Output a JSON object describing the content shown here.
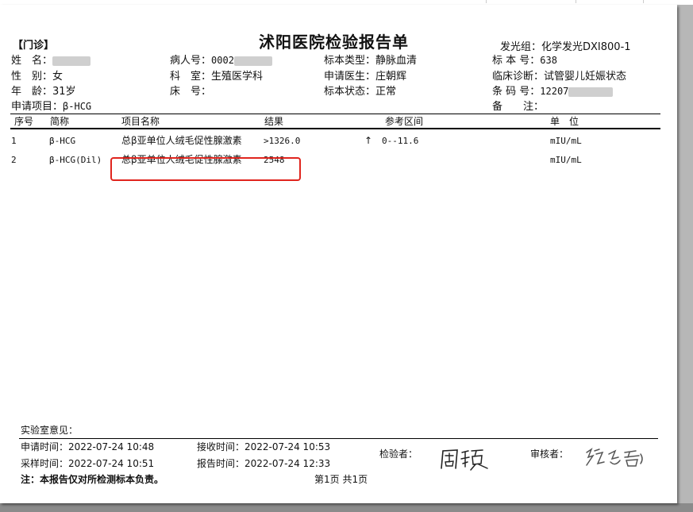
{
  "header": {
    "clinic": "【门诊】",
    "title": "沭阳医院检验报告单",
    "instrument_group": "发光组：化学发光DXI800-1"
  },
  "patient": {
    "name_label": "姓　名：",
    "gender_label": "性　别：",
    "gender_value": "女",
    "age_label": "年　龄：",
    "age_value": "31岁",
    "request_label": "申请项目：",
    "request_value": "β-HCG",
    "patient_no_label": "病人号：",
    "patient_no_value": "0002",
    "dept_label": "科　室：",
    "dept_value": "生殖医学科",
    "bed_label": "床　号：",
    "bed_value": "",
    "specimen_type_label": "标本类型：",
    "specimen_type_value": "静脉血清",
    "doctor_label": "申请医生：",
    "doctor_value": "庄朝辉",
    "specimen_status_label": "标本状态：",
    "specimen_status_value": "正常",
    "specimen_no_label": "标 本 号：",
    "specimen_no_value": "638",
    "diagnosis_label": "临床诊断：",
    "diagnosis_value": "试管婴儿妊娠状态",
    "barcode_label": "条 码 号：",
    "barcode_value": "12207",
    "remark_label": "备　　注："
  },
  "table": {
    "headers": [
      "序号",
      "简称",
      "项目名称",
      "结果",
      "参考区间",
      "单　位"
    ],
    "rows": [
      {
        "no": "1",
        "abbr": "β-HCG",
        "name": "总β亚单位人绒毛促性腺激素",
        "result": ">1326.0",
        "flag": "↑",
        "ref": "0--11.6",
        "unit": "mIU/mL"
      },
      {
        "no": "2",
        "abbr": "β-HCG(Dil)",
        "name": "总β亚单位人绒毛促性腺激素",
        "result": "2548",
        "flag": "",
        "ref": "",
        "unit": "mIU/mL"
      }
    ]
  },
  "footer": {
    "lab_opinion_label": "实验室意见：",
    "request_time": "申请时间：2022-07-24 10:48",
    "collect_time": "采样时间：2022-07-24 10:51",
    "receive_time": "接收时间：2022-07-24 10:53",
    "report_time": "报告时间：2022-07-24 12:33",
    "inspector_label": "检验者：",
    "reviewer_label": "审核者：",
    "note": "注：本报告仅对所检测标本负责。",
    "page_info": "第1页  共1页"
  },
  "colors": {
    "highlight": "#e0251e"
  }
}
